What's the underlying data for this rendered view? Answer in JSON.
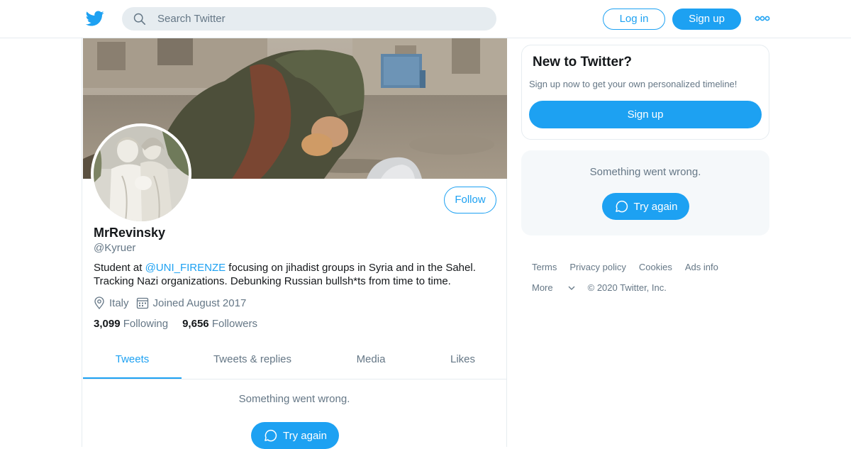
{
  "header": {
    "logo_icon": "twitter-bird-icon",
    "search_placeholder": "Search Twitter",
    "login_label": "Log in",
    "signup_label": "Sign up",
    "more_icon": "more-dots-icon"
  },
  "profile": {
    "follow_label": "Follow",
    "name": "MrRevinsky",
    "handle": "@Kyruer",
    "bio_prefix": "Student at ",
    "bio_mention": "@UNI_FIRENZE",
    "bio_rest": " focusing on jihadist groups in Syria and in the Sahel. Tracking Nazi organizations. Debunking Russian bullsh*ts from time to time.",
    "location": "Italy",
    "joined": "Joined August 2017",
    "following_count": "3,099",
    "following_label": "Following",
    "followers_count": "9,656",
    "followers_label": "Followers"
  },
  "tabs": [
    {
      "label": "Tweets",
      "active": true
    },
    {
      "label": "Tweets & replies",
      "active": false
    },
    {
      "label": "Media",
      "active": false
    },
    {
      "label": "Likes",
      "active": false
    }
  ],
  "timeline": {
    "error_message": "Something went wrong.",
    "retry_label": "Try again"
  },
  "sidebar": {
    "card_title": "New to Twitter?",
    "card_text": "Sign up now to get your own personalized timeline!",
    "card_signup_label": "Sign up",
    "error_message": "Something went wrong.",
    "retry_label": "Try again"
  },
  "footer": {
    "links_row1": [
      "Terms",
      "Privacy policy",
      "Cookies",
      "Ads info"
    ],
    "more_label": "More",
    "copyright": "© 2020 Twitter, Inc."
  },
  "colors": {
    "accent": "#1da1f2",
    "text_primary": "#14171a",
    "text_secondary": "#657786",
    "border": "#e6ecf0",
    "panel_bg": "#f5f8fa"
  }
}
